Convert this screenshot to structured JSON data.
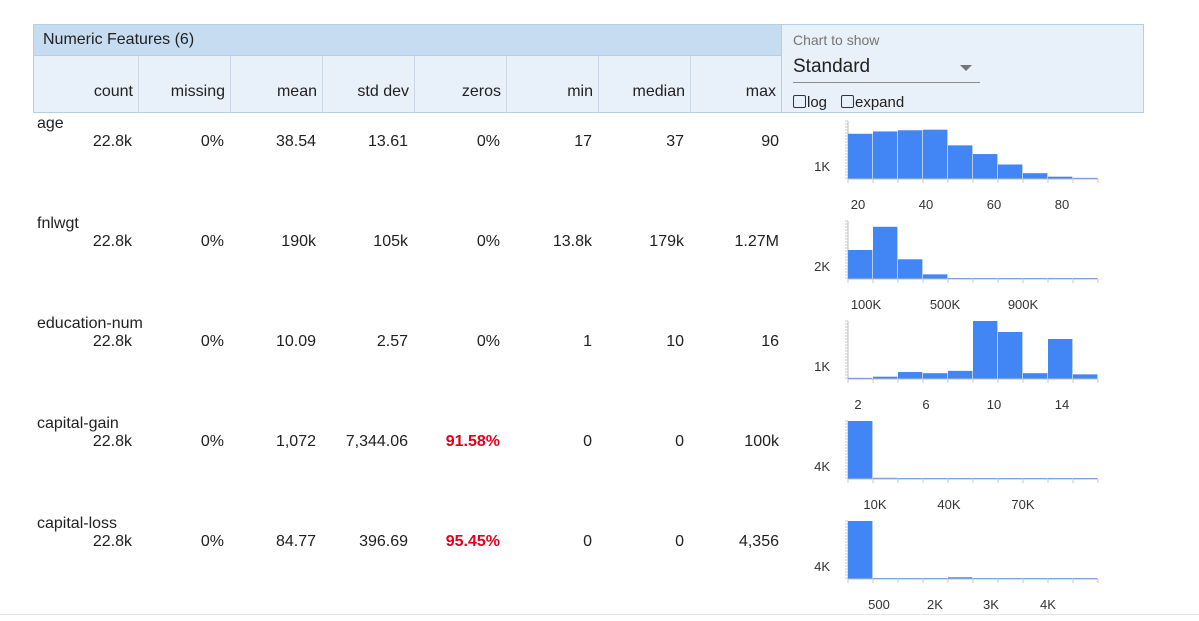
{
  "table": {
    "title": "Numeric Features (6)",
    "columns": [
      "count",
      "missing",
      "mean",
      "std dev",
      "zeros",
      "min",
      "median",
      "max"
    ]
  },
  "controls": {
    "chart_label": "Chart to show",
    "chart_value": "Standard",
    "log_label": "log",
    "expand_label": "expand"
  },
  "colors": {
    "bar": "#4285f4",
    "warning": "#e0001b",
    "header": "#c5dcf1",
    "header_light": "#e8f0f9"
  },
  "features": [
    {
      "name": "age",
      "count": "22.8k",
      "missing": "0%",
      "mean": "38.54",
      "std_dev": "13.61",
      "zeros": "0%",
      "zeros_flag": false,
      "min": "17",
      "median": "37",
      "max": "90",
      "histogram": {
        "y_label": "1K",
        "x_ticks": [
          "20",
          "40",
          "60",
          "80"
        ],
        "bins": [
          0.78,
          0.82,
          0.84,
          0.85,
          0.58,
          0.43,
          0.25,
          0.1,
          0.04,
          0.02
        ]
      }
    },
    {
      "name": "fnlwgt",
      "count": "22.8k",
      "missing": "0%",
      "mean": "190k",
      "std_dev": "105k",
      "zeros": "0%",
      "zeros_flag": false,
      "min": "13.8k",
      "median": "179k",
      "max": "1.27M",
      "histogram": {
        "y_label": "2K",
        "x_ticks": [
          "100K",
          "500K",
          "900K"
        ],
        "bins": [
          0.5,
          0.9,
          0.34,
          0.08,
          0.01,
          0.005,
          0.002,
          0.001,
          0.001,
          0.001
        ]
      }
    },
    {
      "name": "education-num",
      "count": "22.8k",
      "missing": "0%",
      "mean": "10.09",
      "std_dev": "2.57",
      "zeros": "0%",
      "zeros_flag": false,
      "min": "1",
      "median": "10",
      "max": "16",
      "histogram": {
        "y_label": "1K",
        "x_ticks": [
          "2",
          "6",
          "10",
          "14"
        ],
        "bins": [
          0.02,
          0.04,
          0.12,
          0.1,
          0.14,
          1.0,
          0.81,
          0.1,
          0.69,
          0.08
        ]
      }
    },
    {
      "name": "capital-gain",
      "count": "22.8k",
      "missing": "0%",
      "mean": "1,072",
      "std_dev": "7,344.06",
      "zeros": "91.58%",
      "zeros_flag": true,
      "min": "0",
      "median": "0",
      "max": "100k",
      "histogram": {
        "y_label": "4K",
        "x_ticks": [
          "10K",
          "40K",
          "70K"
        ],
        "bins": [
          1.0,
          0.02,
          0.005,
          0.001,
          0.001,
          0.001,
          0.001,
          0.001,
          0.001,
          0.005
        ]
      }
    },
    {
      "name": "capital-loss",
      "count": "22.8k",
      "missing": "0%",
      "mean": "84.77",
      "std_dev": "396.69",
      "zeros": "95.45%",
      "zeros_flag": true,
      "min": "0",
      "median": "0",
      "max": "4,356",
      "histogram": {
        "y_label": "4K",
        "x_ticks": [
          "500",
          "2K",
          "3K",
          "4K"
        ],
        "bins": [
          1.0,
          0.003,
          0.003,
          0.01,
          0.03,
          0.01,
          0.003,
          0.002,
          0.001,
          0.001
        ]
      }
    }
  ]
}
